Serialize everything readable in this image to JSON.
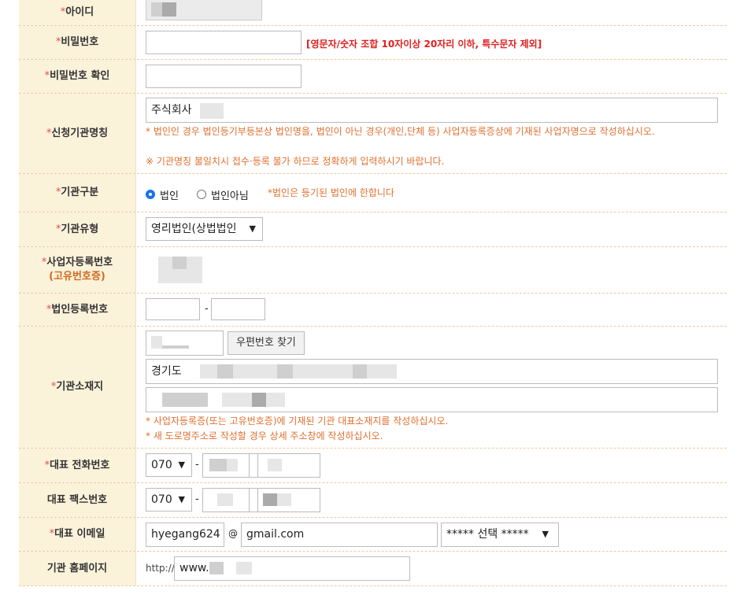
{
  "req_mark": "*",
  "rows": {
    "userid": {
      "label": "아이디"
    },
    "password": {
      "label": "비밀번호",
      "hint": "[영문자/숫자 조합 10자이상 20자리 이하, 특수문자 제외]"
    },
    "password_confirm": {
      "label": "비밀번호 확인"
    },
    "org_name": {
      "label": "신청기관명칭",
      "value": "주식회사",
      "note1": "* 법인인 경우 법인등기부등본상 법인명을, 법인이 아닌 경우(개인,단체 등) 사업자등록증상에 기재된 사업자명으로 작성하십시오.",
      "note2": "※ 기관명칭 불일치시 접수·등록 불가 하므로 정확하게 입력하시기 바랍니다."
    },
    "org_class": {
      "label": "기관구분",
      "opt1": "법인",
      "opt2": "법인아님",
      "note": "*법인은 등기된 법인에 한합니다",
      "selected": "법인"
    },
    "org_type": {
      "label": "기관유형",
      "value": "영리법인(상법법인"
    },
    "bizno": {
      "label": "사업자등록번호",
      "sublabel": "(고유번호증)"
    },
    "corpno": {
      "label": "법인등록번호",
      "dash": "-"
    },
    "address": {
      "label": "기관소재지",
      "zip_button": "우편번호 찾기",
      "addr1": "경기도",
      "note1": "* 사업자등록증(또는 고유번호증)에 기재된 기관 대표소재지를 작성하십시오.",
      "note2": "* 새 도로명주소로 작성할 경우 상세 주소창에 작성하십시오."
    },
    "phone": {
      "label": "대표 전화번호",
      "area": "070",
      "dash": "-"
    },
    "fax": {
      "label": "대표 팩스번호",
      "area": "070",
      "dash": "-"
    },
    "email": {
      "label": "대표 이메일",
      "local": "hyegang624",
      "at": "@",
      "domain": "gmail.com",
      "select": "***** 선택 *****"
    },
    "homepage": {
      "label": "기관 홈페이지",
      "prefix": "http://",
      "value": "www."
    }
  },
  "icons": {
    "dropdown": "triangle-down"
  },
  "colors": {
    "label_bg": "#fbf2da",
    "required": "#d9534f",
    "note": "#e07030",
    "hint": "#e02020",
    "radio_on": "#1a73e8"
  }
}
